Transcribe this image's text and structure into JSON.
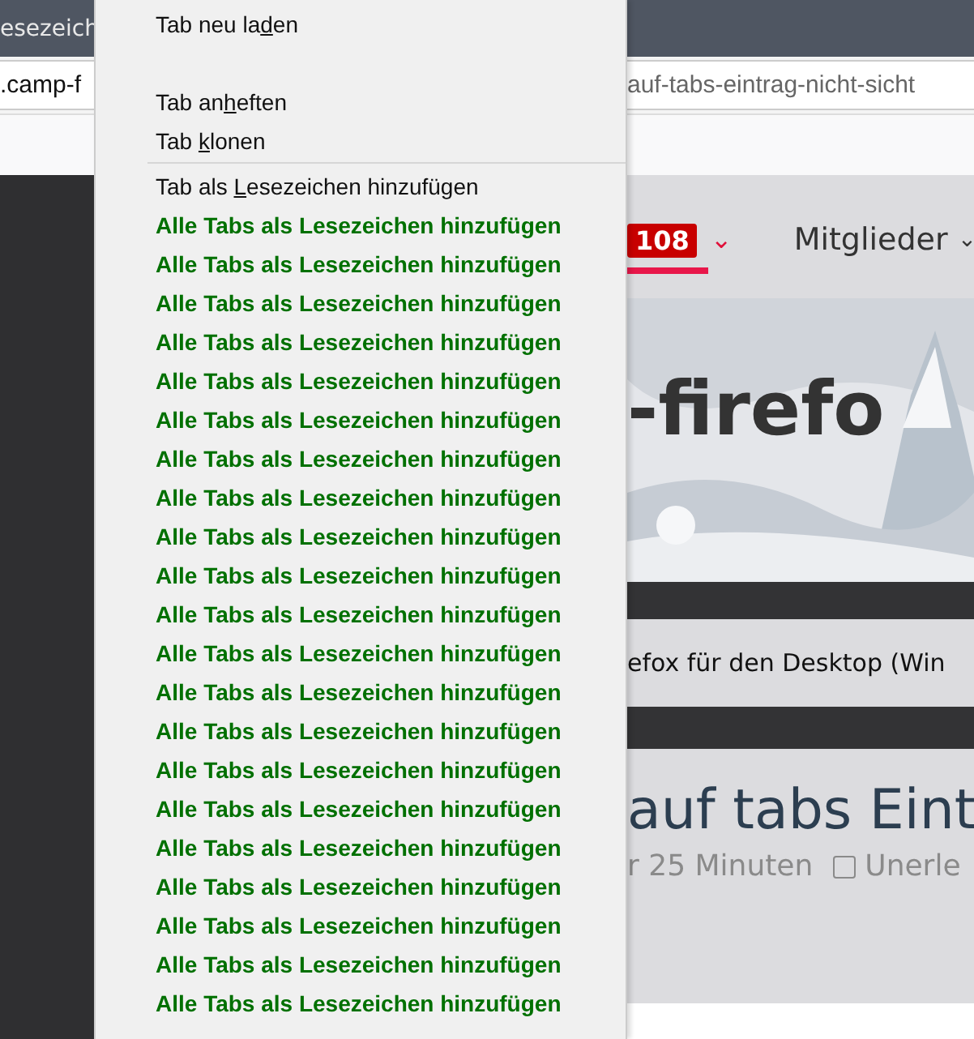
{
  "tab": {
    "title": "esezeich"
  },
  "address_bar": {
    "left_text": ".camp-f",
    "right_text": "auf-tabs-eintrag-nicht-sicht"
  },
  "page": {
    "nav": {
      "badge": "108",
      "caret": "⌄",
      "menu_label": "Mitglieder",
      "menu_caret": "⌄"
    },
    "banner_text": "-firefo",
    "breadcrumb": "efox für den Desktop (Win",
    "thread_title": "auf tabs Eint",
    "meta": [
      {
        "kind": "text",
        "text": "r 25 Minuten"
      },
      {
        "kind": "checkbox",
        "text": "Unerle"
      }
    ]
  },
  "context_menu": {
    "items": [
      {
        "kind": "item",
        "label": [
          "Tab neu la",
          "d",
          "en"
        ]
      },
      {
        "kind": "gap"
      },
      {
        "kind": "item",
        "label": [
          "Tab an",
          "h",
          "eften"
        ]
      },
      {
        "kind": "item",
        "label": [
          "Tab ",
          "k",
          "lonen"
        ]
      },
      {
        "kind": "separator"
      },
      {
        "kind": "item",
        "label": [
          "Tab als ",
          "L",
          "esezeichen hinzufügen"
        ]
      },
      {
        "kind": "bold",
        "label": [
          "Alle Tabs als Lesezeichen hinzufügen"
        ]
      },
      {
        "kind": "bold",
        "label": [
          "Alle Tabs als Lesezeichen hinzufügen"
        ]
      },
      {
        "kind": "bold",
        "label": [
          "Alle Tabs als Lesezeichen hinzufügen"
        ]
      },
      {
        "kind": "bold",
        "label": [
          "Alle Tabs als Lesezeichen hinzufügen"
        ]
      },
      {
        "kind": "bold",
        "label": [
          "Alle Tabs als Lesezeichen hinzufügen"
        ]
      },
      {
        "kind": "bold",
        "label": [
          "Alle Tabs als Lesezeichen hinzufügen"
        ]
      },
      {
        "kind": "bold",
        "label": [
          "Alle Tabs als Lesezeichen hinzufügen"
        ]
      },
      {
        "kind": "bold",
        "label": [
          "Alle Tabs als Lesezeichen hinzufügen"
        ]
      },
      {
        "kind": "bold",
        "label": [
          "Alle Tabs als Lesezeichen hinzufügen"
        ]
      },
      {
        "kind": "bold",
        "label": [
          "Alle Tabs als Lesezeichen hinzufügen"
        ]
      },
      {
        "kind": "bold",
        "label": [
          "Alle Tabs als Lesezeichen hinzufügen"
        ]
      },
      {
        "kind": "bold",
        "label": [
          "Alle Tabs als Lesezeichen hinzufügen"
        ]
      },
      {
        "kind": "bold",
        "label": [
          "Alle Tabs als Lesezeichen hinzufügen"
        ]
      },
      {
        "kind": "bold",
        "label": [
          "Alle Tabs als Lesezeichen hinzufügen"
        ]
      },
      {
        "kind": "bold",
        "label": [
          "Alle Tabs als Lesezeichen hinzufügen"
        ]
      },
      {
        "kind": "bold",
        "label": [
          "Alle Tabs als Lesezeichen hinzufügen"
        ]
      },
      {
        "kind": "bold",
        "label": [
          "Alle Tabs als Lesezeichen hinzufügen"
        ]
      },
      {
        "kind": "bold",
        "label": [
          "Alle Tabs als Lesezeichen hinzufügen"
        ]
      },
      {
        "kind": "bold",
        "label": [
          "Alle Tabs als Lesezeichen hinzufügen"
        ]
      },
      {
        "kind": "bold",
        "label": [
          "Alle Tabs als Lesezeichen hinzufügen"
        ]
      },
      {
        "kind": "bold",
        "label": [
          "Alle Tabs als Lesezeichen hinzufügen"
        ]
      }
    ]
  }
}
